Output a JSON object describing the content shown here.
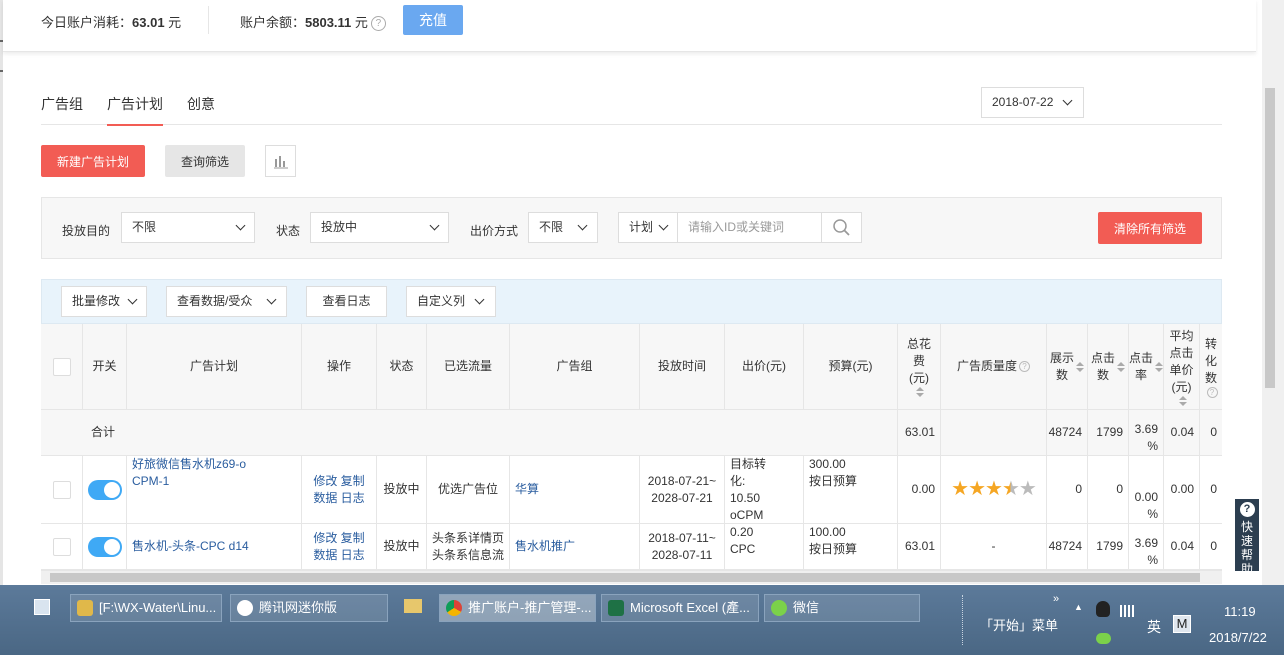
{
  "topbar": {
    "today_spend_label": "今日账户消耗：",
    "today_spend_value": "63.01",
    "today_spend_unit": " 元",
    "balance_label": "账户余额：",
    "balance_value": "5803.11",
    "balance_unit": " 元",
    "recharge_label": "充值"
  },
  "tabs": [
    {
      "label": "广告组"
    },
    {
      "label": "广告计划"
    },
    {
      "label": "创意"
    }
  ],
  "date_filter": "2018-07-22",
  "actions": {
    "new_plan": "新建广告计划",
    "query_filter": "查询筛选"
  },
  "filters": {
    "goal_label": "投放目的",
    "goal_value": "不限",
    "status_label": "状态",
    "status_value": "投放中",
    "bid_label": "出价方式",
    "bid_value": "不限",
    "search_scope": "计划",
    "search_placeholder": "请输入ID或关键词",
    "clear_label": "清除所有筛选"
  },
  "toolbar": {
    "batch_edit": "批量修改",
    "view_data": "查看数据/受众",
    "view_log": "查看日志",
    "custom_columns": "自定义列"
  },
  "table": {
    "headers": {
      "switch": "开关",
      "plan": "广告计划",
      "ops": "操作",
      "status": "状态",
      "traffic": "已选流量",
      "group": "广告组",
      "time": "投放时间",
      "bid": "出价(元)",
      "budget": "预算(元)",
      "cost_a": "总花",
      "cost_b": "费",
      "cost_c": "(元)",
      "quality": "广告质量度",
      "impr_a": "展示",
      "impr_b": "数",
      "clicks_a": "点击",
      "clicks_b": "数",
      "ctr_a": "点击",
      "ctr_b": "率",
      "cpc_a": "平均",
      "cpc_b": "点击",
      "cpc_c": "单价",
      "cpc_d": "(元)",
      "conv_a": "转",
      "conv_b": "化数"
    },
    "summary": {
      "label": "合计",
      "cost": "63.01",
      "impressions": "48724",
      "clicks": "1799",
      "ctr_a": "3.69",
      "ctr_b": "%",
      "cpc": "0.04",
      "conv": "0"
    },
    "rows": [
      {
        "plan_a": "好旅微信售水机z69-o",
        "plan_b": "CPM-1",
        "op_edit": "修改",
        "op_copy": "复制",
        "op_data": "数据",
        "op_log": "日志",
        "status": "投放中",
        "traffic": "优选广告位",
        "group": "华算",
        "time_a": "2018-07-21~",
        "time_b": "2028-07-21",
        "bid_a": "目标转",
        "bid_b": "化:",
        "bid_c": "10.50",
        "bid_d": "oCPM",
        "budget_a": "300.00",
        "budget_b": "按日预算",
        "cost": "0.00",
        "quality_stars": 3.5,
        "impressions": "0",
        "clicks": "0",
        "ctr_a": "0.00",
        "ctr_b": "%",
        "cpc": "0.00",
        "conv": "0"
      },
      {
        "plan_a": "售水机-头条-CPC d14",
        "op_edit": "修改",
        "op_copy": "复制",
        "op_data": "数据",
        "op_log": "日志",
        "status": "投放中",
        "traffic_a": "头条系详情页",
        "traffic_b": "头条系信息流",
        "group": "售水机推广",
        "time_a": "2018-07-11~",
        "time_b": "2028-07-11",
        "bid_a": "0.20",
        "bid_b": "CPC",
        "budget_a": "100.00",
        "budget_b": "按日预算",
        "cost": "63.01",
        "quality": "-",
        "impressions": "48724",
        "clicks": "1799",
        "ctr_a": "3.69",
        "ctr_b": "%",
        "cpc": "0.04",
        "conv": "0"
      }
    ]
  },
  "help_float": {
    "a": "快",
    "b": "速",
    "c": "帮",
    "d": "助"
  },
  "taskbar": {
    "tasks": [
      {
        "label": "[F:\\WX-Water\\Linu..."
      },
      {
        "label": "腾讯网迷你版"
      },
      {
        "label": "推广账户-推广管理-..."
      },
      {
        "label": "Microsoft Excel (產..."
      },
      {
        "label": "微信"
      }
    ],
    "start_menu": "「开始」菜单",
    "ime": "英",
    "ime_mode": "M",
    "time": "11:19",
    "date": "2018/7/22"
  },
  "colors": {
    "accent_red": "#f25c54",
    "accent_blue": "#6aa8f0",
    "toggle_on": "#3fa9f5",
    "star": "#f5a623"
  }
}
